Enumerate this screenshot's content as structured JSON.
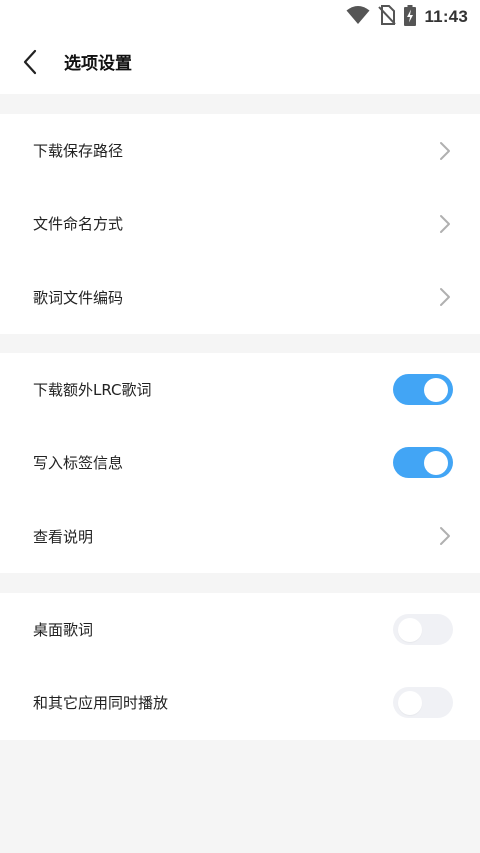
{
  "status_bar": {
    "time": "11:43",
    "icons": [
      "wifi-icon",
      "no-sim-icon",
      "battery-charging-icon"
    ]
  },
  "header": {
    "title": "选项设置",
    "back_icon": "back-arrow-icon"
  },
  "groups": [
    {
      "items": [
        {
          "label": "下载保存路径",
          "control": "chevron"
        },
        {
          "label": "文件命名方式",
          "control": "chevron"
        },
        {
          "label": "歌词文件编码",
          "control": "chevron"
        }
      ]
    },
    {
      "items": [
        {
          "label": "下载额外LRC歌词",
          "control": "toggle",
          "on": true
        },
        {
          "label": "写入标签信息",
          "control": "toggle",
          "on": true
        },
        {
          "label": "查看说明",
          "control": "chevron"
        }
      ]
    },
    {
      "items": [
        {
          "label": "桌面歌词",
          "control": "toggle",
          "on": false
        },
        {
          "label": "和其它应用同时播放",
          "control": "toggle",
          "on": false
        }
      ]
    }
  ],
  "colors": {
    "accent": "#42a5f5",
    "background": "#f5f5f5",
    "surface": "#ffffff",
    "toggle_off": "#f0f1f5",
    "chevron": "#b0b0b0"
  }
}
